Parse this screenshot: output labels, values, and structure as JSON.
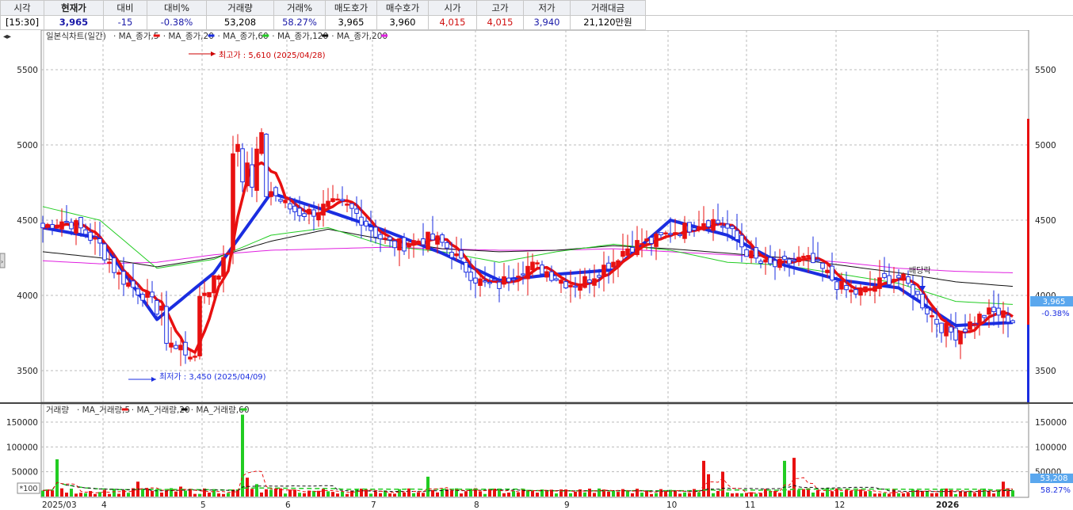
{
  "quote": {
    "headers": [
      "시각",
      "현재가",
      "대비",
      "대비%",
      "거래량",
      "거래%",
      "매도호가",
      "매수호가",
      "시가",
      "고가",
      "저가",
      "거래대금"
    ],
    "values": [
      "[15:30]",
      "3,965",
      "-15",
      "-0.38%",
      "53,208",
      "58.27%",
      "3,965",
      "3,960",
      "4,015",
      "4,015",
      "3,940",
      "21,120만원"
    ]
  },
  "price_panel": {
    "legend": {
      "title": "일본식차트(일간)",
      "items": [
        {
          "label": "MA_종가,5",
          "color": "#e81010"
        },
        {
          "label": "MA_종가,20",
          "color": "#1a2de0"
        },
        {
          "label": "MA_종가,60",
          "color": "#22cc22"
        },
        {
          "label": "MA_종가,120",
          "color": "#111111"
        },
        {
          "label": "MA_종가,200",
          "color": "#e020e0"
        }
      ]
    },
    "high_annotation": "최고가 : 5,610 (2025/04/28)",
    "low_annotation": "최저가 : 3,450 (2025/04/09)",
    "dividend_label": "배당락",
    "current_price_tag": "3,965",
    "current_change_tag": "-0.38%",
    "y_ticks": [
      "5500",
      "5000",
      "4500",
      "4000",
      "3500"
    ]
  },
  "volume_panel": {
    "legend": {
      "title": "거래량",
      "items": [
        {
          "label": "MA_거래량,5",
          "color": "#e81010"
        },
        {
          "label": "MA_거래량,20",
          "color": "#111111"
        },
        {
          "label": "MA_거래량,60",
          "color": "#22cc22"
        }
      ]
    },
    "unit_label": "*100",
    "y_ticks": [
      "150000",
      "100000",
      "50000"
    ],
    "current_volume_tag": "53,208",
    "current_ratio_tag": "58.27%"
  },
  "x_axis": {
    "labels": [
      "2025/03",
      "4",
      "5",
      "6",
      "7",
      "8",
      "9",
      "10",
      "11",
      "12",
      "2026"
    ]
  },
  "colors": {
    "up": "#e81010",
    "down": "#1a2de0",
    "ma5": "#e81010",
    "ma20": "#1a2de0",
    "ma60": "#22cc22",
    "ma120": "#111111",
    "ma200": "#e020e0"
  },
  "chart_data": {
    "type": "candlestick",
    "price_axis_ticks": [
      3500,
      4000,
      4500,
      5000,
      5500
    ],
    "volume_axis_ticks": [
      50000,
      100000,
      150000
    ],
    "high_point": {
      "value": 5610,
      "date": "2025/04/28"
    },
    "low_point": {
      "value": 3450,
      "date": "2025/04/09"
    },
    "months": [
      "2025/03",
      "4",
      "5",
      "6",
      "7",
      "8",
      "9",
      "10",
      "11",
      "12",
      "2026"
    ],
    "ma20_approx": [
      4450,
      4380,
      3840,
      4150,
      4680,
      4560,
      4430,
      4280,
      4100,
      4140,
      4170,
      4500,
      4400,
      4200,
      4100,
      4050,
      3800,
      3820
    ],
    "ma60_approx": [
      4590,
      4500,
      4180,
      4240,
      4400,
      4450,
      4330,
      4290,
      4220,
      4290,
      4340,
      4300,
      4220,
      4200,
      4140,
      4080,
      3960,
      3940
    ],
    "ma120_approx": [
      4290,
      4250,
      4190,
      4250,
      4360,
      4440,
      4370,
      4310,
      4290,
      4300,
      4330,
      4310,
      4280,
      4250,
      4200,
      4150,
      4090,
      4060
    ],
    "ma200_approx": [
      4230,
      4210,
      4220,
      4270,
      4300,
      4310,
      4320,
      4310,
      4300,
      4300,
      4310,
      4290,
      4270,
      4250,
      4220,
      4180,
      4160,
      4150
    ]
  }
}
